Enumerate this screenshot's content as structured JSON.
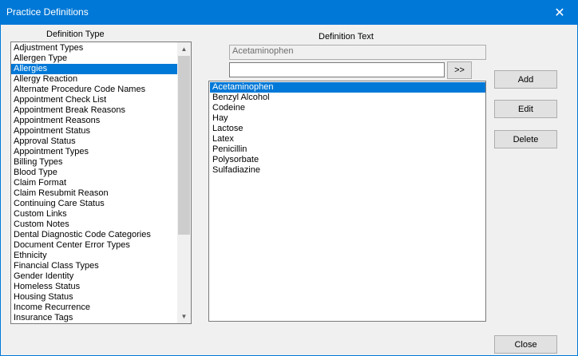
{
  "window": {
    "title": "Practice Definitions",
    "close_glyph": "✕"
  },
  "labels": {
    "definition_type": "Definition Type",
    "definition_text": "Definition Text"
  },
  "definition_types": [
    "Adjustment Types",
    "Allergen Type",
    "Allergies",
    "Allergy Reaction",
    "Alternate Procedure Code Names",
    "Appointment Check List",
    "Appointment Break Reasons",
    "Appointment Reasons",
    "Appointment Status",
    "Approval Status",
    "Appointment Types",
    "Billing Types",
    "Blood Type",
    "Claim Format",
    "Claim Resubmit Reason",
    "Continuing Care Status",
    "Custom Links",
    "Custom Notes",
    "Dental Diagnostic Code Categories",
    "Document Center Error Types",
    "Ethnicity",
    "Financial Class Types",
    "Gender Identity",
    "Homeless Status",
    "Housing Status",
    "Income Recurrence",
    "Insurance Tags"
  ],
  "selected_type": "Allergies",
  "definition_text_value": "Acetaminophen",
  "definition_text_input": "",
  "arrow_button_label": ">>",
  "definition_texts": [
    "Acetaminophen",
    "Benzyl Alcohol",
    "Codeine",
    "Hay",
    "Lactose",
    "Latex",
    "Penicillin",
    "Polysorbate",
    "Sulfadiazine"
  ],
  "selected_text": "Acetaminophen",
  "buttons": {
    "add": "Add",
    "edit": "Edit",
    "delete": "Delete",
    "close": "Close"
  },
  "scroll_icons": {
    "up": "chevron-up-icon",
    "down": "chevron-down-icon"
  },
  "colors": {
    "title_bar": "#0078d7",
    "selection": "#0078d7"
  }
}
